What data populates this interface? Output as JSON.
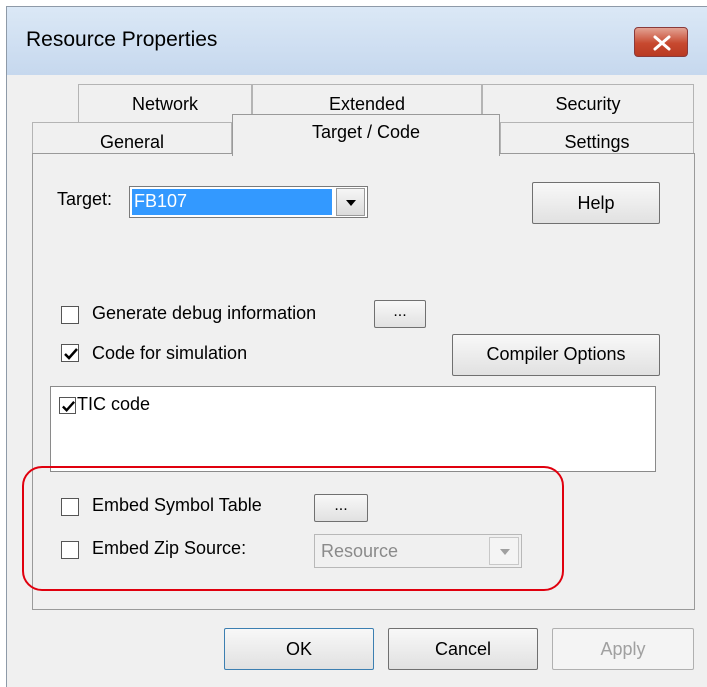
{
  "window": {
    "title": "Resource Properties"
  },
  "tabs": {
    "back_row": [
      "Network",
      "Extended",
      "Security"
    ],
    "front_row": [
      "General",
      "Target / Code",
      "Settings"
    ],
    "active": "Target / Code"
  },
  "target": {
    "label": "Target:",
    "value": "FB107"
  },
  "help_label": "Help",
  "debug": {
    "label": "Generate debug information",
    "checked": false,
    "button": "..."
  },
  "simulation": {
    "label": "Code for simulation",
    "checked": true
  },
  "compiler_options_label": "Compiler Options",
  "code_list": {
    "items": [
      {
        "label": "TIC code",
        "checked": true
      }
    ]
  },
  "embed_symbol": {
    "label": "Embed Symbol Table",
    "checked": false,
    "button": "..."
  },
  "embed_zip": {
    "label": "Embed Zip Source:",
    "checked": false,
    "select_value": "Resource"
  },
  "footer": {
    "ok": "OK",
    "cancel": "Cancel",
    "apply": "Apply"
  },
  "colors": {
    "highlight": "#e0000e",
    "selection": "#3399ff"
  }
}
